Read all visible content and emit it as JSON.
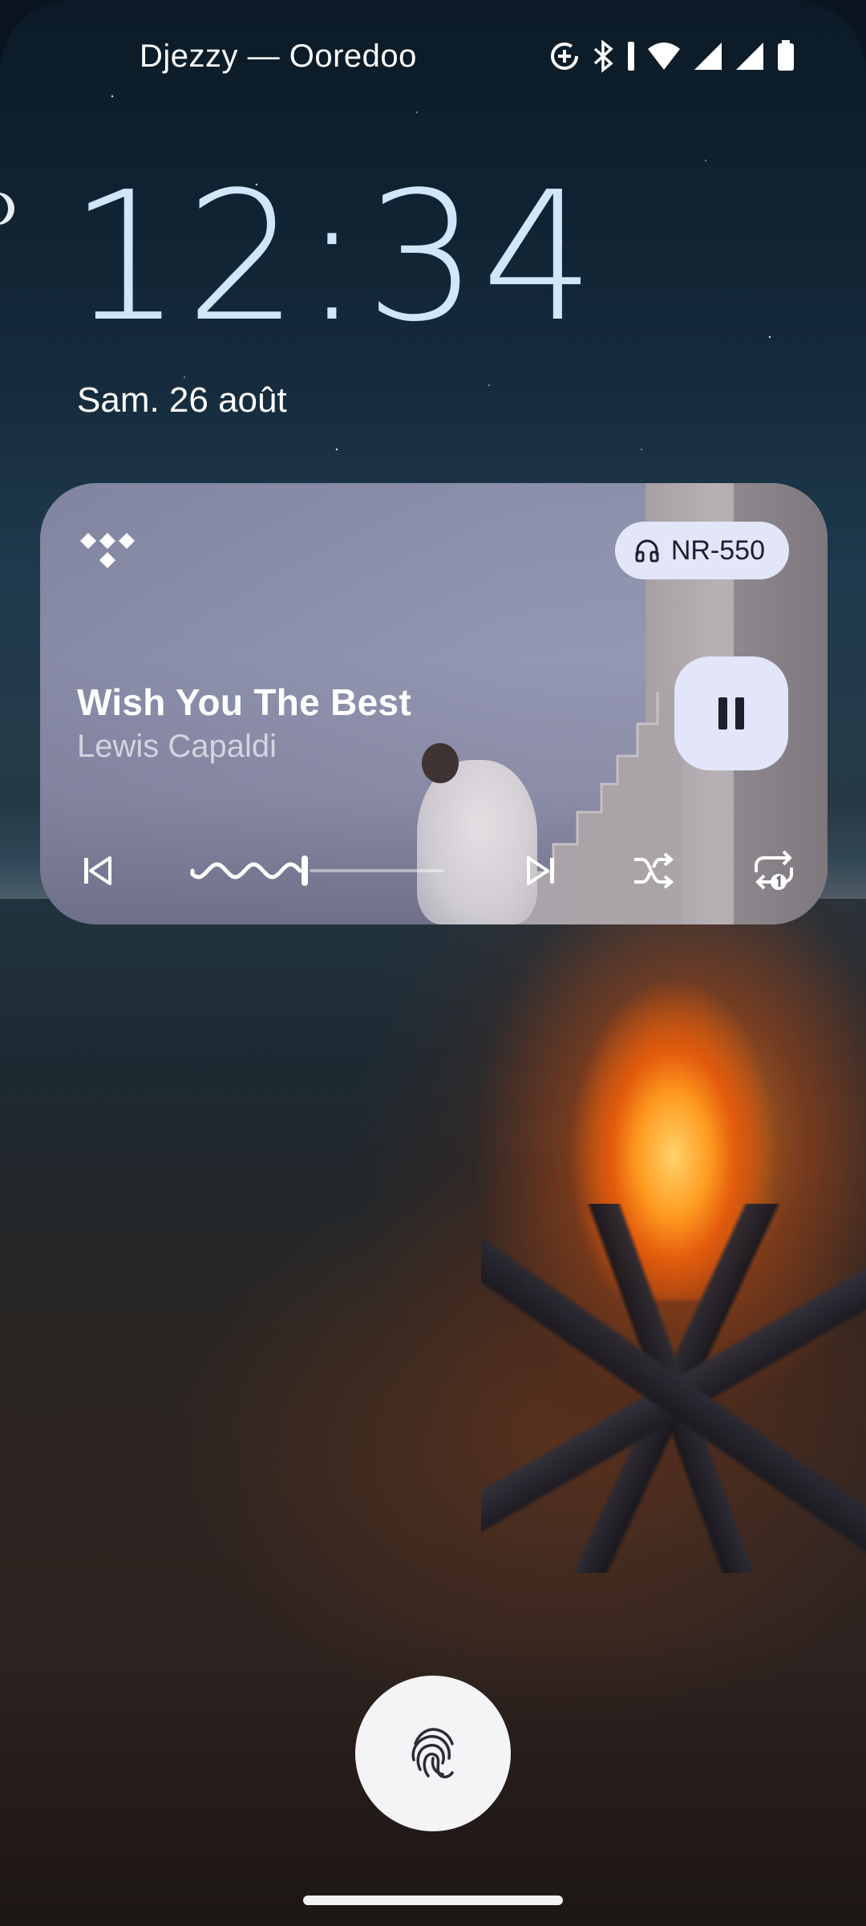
{
  "status_bar": {
    "carrier": "Djezzy — Ooredoo",
    "icons": [
      "data-saver-icon",
      "bluetooth-icon",
      "wifi-icon",
      "signal-icon",
      "signal-icon-2",
      "battery-icon"
    ]
  },
  "lockscreen": {
    "time": "12:34",
    "date": "Sam. 26 août"
  },
  "media": {
    "app_icon": "tidal-logo",
    "output_device": "NR-550",
    "output_icon": "headphones-icon",
    "title": "Wish You The Best",
    "artist": "Lewis Capaldi",
    "state": "playing",
    "progress": 0.45,
    "controls": [
      "previous-icon",
      "next-icon",
      "shuffle-icon",
      "repeat-one-icon"
    ]
  },
  "bottom": {
    "unlock_icon": "fingerprint-icon"
  },
  "colors": {
    "clock": "#cfe6fb",
    "chip_bg": "#e3e5f8",
    "play_button_bg": "#e3e5fb"
  }
}
